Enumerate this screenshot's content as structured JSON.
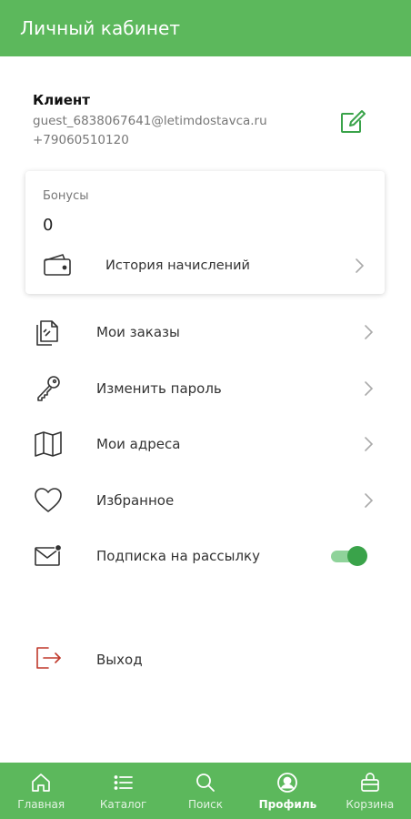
{
  "header": {
    "title": "Личный кабинет"
  },
  "user": {
    "name": "Клиент",
    "email": "guest_6838067641@letimdostavca.ru",
    "phone": "+79060510120",
    "edit_icon": "edit-icon"
  },
  "bonus": {
    "label": "Бонусы",
    "value": "0",
    "history_label": "История начислений",
    "history_icon": "wallet-icon"
  },
  "menu": [
    {
      "label": "Мои заказы",
      "icon": "orders-icon"
    },
    {
      "label": "Изменить пароль",
      "icon": "key-icon"
    },
    {
      "label": "Мои адреса",
      "icon": "map-icon"
    },
    {
      "label": "Избранное",
      "icon": "heart-icon"
    },
    {
      "label": "Подписка на рассылку",
      "icon": "mail-icon",
      "toggle_on": true
    }
  ],
  "logout": {
    "label": "Выход",
    "icon": "logout-icon"
  },
  "nav": [
    {
      "label": "Главная",
      "icon": "home-icon"
    },
    {
      "label": "Каталог",
      "icon": "list-icon"
    },
    {
      "label": "Поиск",
      "icon": "search-icon"
    },
    {
      "label": "Профиль",
      "icon": "profile-icon",
      "active": true
    },
    {
      "label": "Корзина",
      "icon": "basket-icon"
    }
  ],
  "colors": {
    "brand": "#5cb85c",
    "toggle_on": "#3aa34a",
    "logout_icon": "#c0392b"
  }
}
